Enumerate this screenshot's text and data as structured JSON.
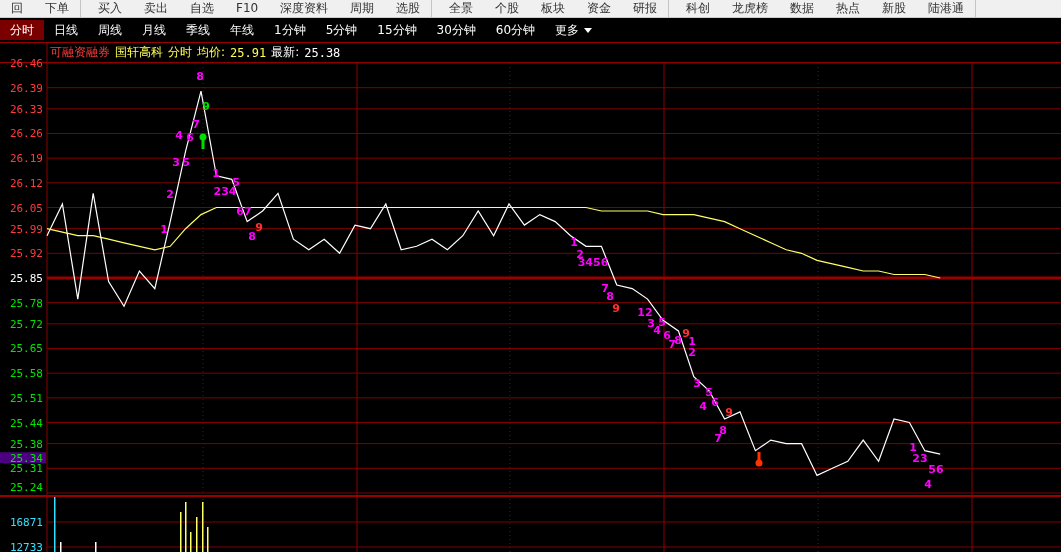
{
  "toolbar": {
    "items": [
      {
        "label": "回",
        "separator_after": false
      },
      {
        "label": "下单",
        "separator_after": true
      },
      {
        "label": "买入",
        "separator_after": false
      },
      {
        "label": "卖出",
        "separator_after": false
      },
      {
        "label": "自选",
        "separator_after": false
      },
      {
        "label": "F10",
        "separator_after": false
      },
      {
        "label": "深度资料",
        "separator_after": false
      },
      {
        "label": "周期",
        "separator_after": false
      },
      {
        "label": "选股",
        "separator_after": true
      },
      {
        "label": "全景",
        "separator_after": false
      },
      {
        "label": "个股",
        "separator_after": false
      },
      {
        "label": "板块",
        "separator_after": false
      },
      {
        "label": "资金",
        "separator_after": false
      },
      {
        "label": "研报",
        "separator_after": true
      },
      {
        "label": "科创",
        "separator_after": false
      },
      {
        "label": "龙虎榜",
        "separator_after": false
      },
      {
        "label": "数据",
        "separator_after": false
      },
      {
        "label": "热点",
        "separator_after": false
      },
      {
        "label": "新股",
        "separator_after": false
      },
      {
        "label": "陆港通",
        "separator_after": true
      }
    ]
  },
  "tabs": [
    {
      "label": "分时",
      "selected": true
    },
    {
      "label": "日线",
      "selected": false
    },
    {
      "label": "周线",
      "selected": false
    },
    {
      "label": "月线",
      "selected": false
    },
    {
      "label": "季线",
      "selected": false
    },
    {
      "label": "年线",
      "selected": false
    },
    {
      "label": "1分钟",
      "selected": false
    },
    {
      "label": "5分钟",
      "selected": false
    },
    {
      "label": "15分钟",
      "selected": false
    },
    {
      "label": "30分钟",
      "selected": false
    },
    {
      "label": "60分钟",
      "selected": false
    },
    {
      "label": "更多",
      "selected": false
    }
  ],
  "header": {
    "margin_tag": "可融资融券",
    "stock_name": "国轩高科",
    "period": "分时",
    "avg_label": "均价:",
    "avg_value": "25.91",
    "last_label": "最新:",
    "last_value": "25.38"
  },
  "current_price": "25.34",
  "volume_ticks": [
    "16871",
    "12733"
  ],
  "chart_data": {
    "type": "line",
    "grid": true,
    "ylim": [
      25.24,
      26.46
    ],
    "yticks": [
      26.46,
      26.39,
      26.33,
      26.26,
      26.19,
      26.12,
      26.05,
      25.99,
      25.92,
      25.85,
      25.78,
      25.72,
      25.65,
      25.58,
      25.51,
      25.44,
      25.38,
      25.31,
      25.24
    ],
    "ref_lines": [
      {
        "axis": "y",
        "value": 25.85,
        "label": "25.85"
      }
    ],
    "series": [
      {
        "color": "#ffffff",
        "values": [
          25.97,
          26.06,
          25.79,
          26.09,
          25.84,
          25.77,
          25.87,
          25.82,
          26.01,
          26.21,
          26.38,
          26.14,
          26.13,
          26.01,
          26.04,
          26.09,
          25.96,
          25.93,
          25.96,
          25.92,
          26.0,
          25.99,
          26.06,
          25.93,
          25.94,
          25.96,
          25.93,
          25.97,
          26.04,
          25.97,
          26.06,
          26.0,
          26.03,
          26.01,
          25.97,
          25.94,
          25.94,
          25.83,
          25.82,
          25.79,
          25.73,
          25.7,
          25.57,
          25.53,
          25.45,
          25.47,
          25.36,
          25.39,
          25.38,
          25.38,
          25.29,
          25.31,
          25.33,
          25.39,
          25.33,
          25.45,
          25.44,
          25.36,
          25.35
        ]
      },
      {
        "color": "#ffff66",
        "values": [
          25.99,
          25.98,
          25.97,
          25.97,
          25.96,
          25.95,
          25.94,
          25.93,
          25.94,
          25.99,
          26.03,
          26.05,
          26.05,
          26.05,
          26.05,
          26.05,
          26.05,
          26.05,
          26.05,
          26.05,
          26.05,
          26.05,
          26.05,
          26.05,
          26.05,
          26.05,
          26.05,
          26.05,
          26.05,
          26.05,
          26.05,
          26.05,
          26.05,
          26.05,
          26.05,
          26.05,
          26.04,
          26.04,
          26.04,
          26.04,
          26.03,
          26.03,
          26.03,
          26.02,
          26.01,
          25.99,
          25.97,
          25.95,
          25.93,
          25.92,
          25.9,
          25.89,
          25.88,
          25.87,
          25.87,
          25.86,
          25.86,
          25.86,
          25.85
        ]
      }
    ]
  },
  "signal_labels": [
    {
      "text": "1",
      "color": "#ff00ff"
    },
    {
      "text": "2",
      "color": "#ff00ff"
    },
    {
      "text": "3",
      "color": "#ff00ff"
    },
    {
      "text": "5",
      "color": "#ff00ff"
    },
    {
      "text": "4",
      "color": "#ff00ff"
    },
    {
      "text": "6",
      "color": "#ff00ff"
    },
    {
      "text": "7",
      "color": "#ff00ff"
    },
    {
      "text": "8",
      "color": "#ff00ff"
    },
    {
      "text": "9",
      "color": "#00e000"
    },
    {
      "text": "1",
      "color": "#ff00ff"
    },
    {
      "text": "5",
      "color": "#ff00ff"
    },
    {
      "text": "234",
      "color": "#ff00ff"
    },
    {
      "text": "67",
      "color": "#ff00ff"
    },
    {
      "text": "8",
      "color": "#ff00ff"
    },
    {
      "text": "9",
      "color": "#ff3030"
    },
    {
      "text": "1",
      "color": "#ff00ff"
    },
    {
      "text": "2",
      "color": "#ff00ff"
    },
    {
      "text": "3456",
      "color": "#ff00ff"
    },
    {
      "text": "7",
      "color": "#ff00ff"
    },
    {
      "text": "8",
      "color": "#ff00ff"
    },
    {
      "text": "9",
      "color": "#ff3030"
    },
    {
      "text": "12",
      "color": "#ff00ff"
    },
    {
      "text": "3",
      "color": "#ff00ff"
    },
    {
      "text": "4",
      "color": "#ff00ff"
    },
    {
      "text": "5",
      "color": "#ff00ff"
    },
    {
      "text": "6",
      "color": "#ff00ff"
    },
    {
      "text": "7",
      "color": "#ff00ff"
    },
    {
      "text": "8",
      "color": "#ff00ff"
    },
    {
      "text": "9",
      "color": "#ff3030"
    },
    {
      "text": "1",
      "color": "#ff00ff"
    },
    {
      "text": "2",
      "color": "#ff00ff"
    },
    {
      "text": "3",
      "color": "#ff00ff"
    },
    {
      "text": "4",
      "color": "#ff00ff"
    },
    {
      "text": "5",
      "color": "#ff00ff"
    },
    {
      "text": "6",
      "color": "#ff00ff"
    },
    {
      "text": "9",
      "color": "#ff3030"
    },
    {
      "text": "8",
      "color": "#ff00ff"
    },
    {
      "text": "7",
      "color": "#ff00ff"
    },
    {
      "text": "1",
      "color": "#ff00ff"
    },
    {
      "text": "23",
      "color": "#ff00ff"
    },
    {
      "text": "56",
      "color": "#ff00ff"
    },
    {
      "text": "4",
      "color": "#ff00ff"
    }
  ],
  "markers": [
    {
      "kind": "sell"
    },
    {
      "kind": "buy"
    }
  ]
}
